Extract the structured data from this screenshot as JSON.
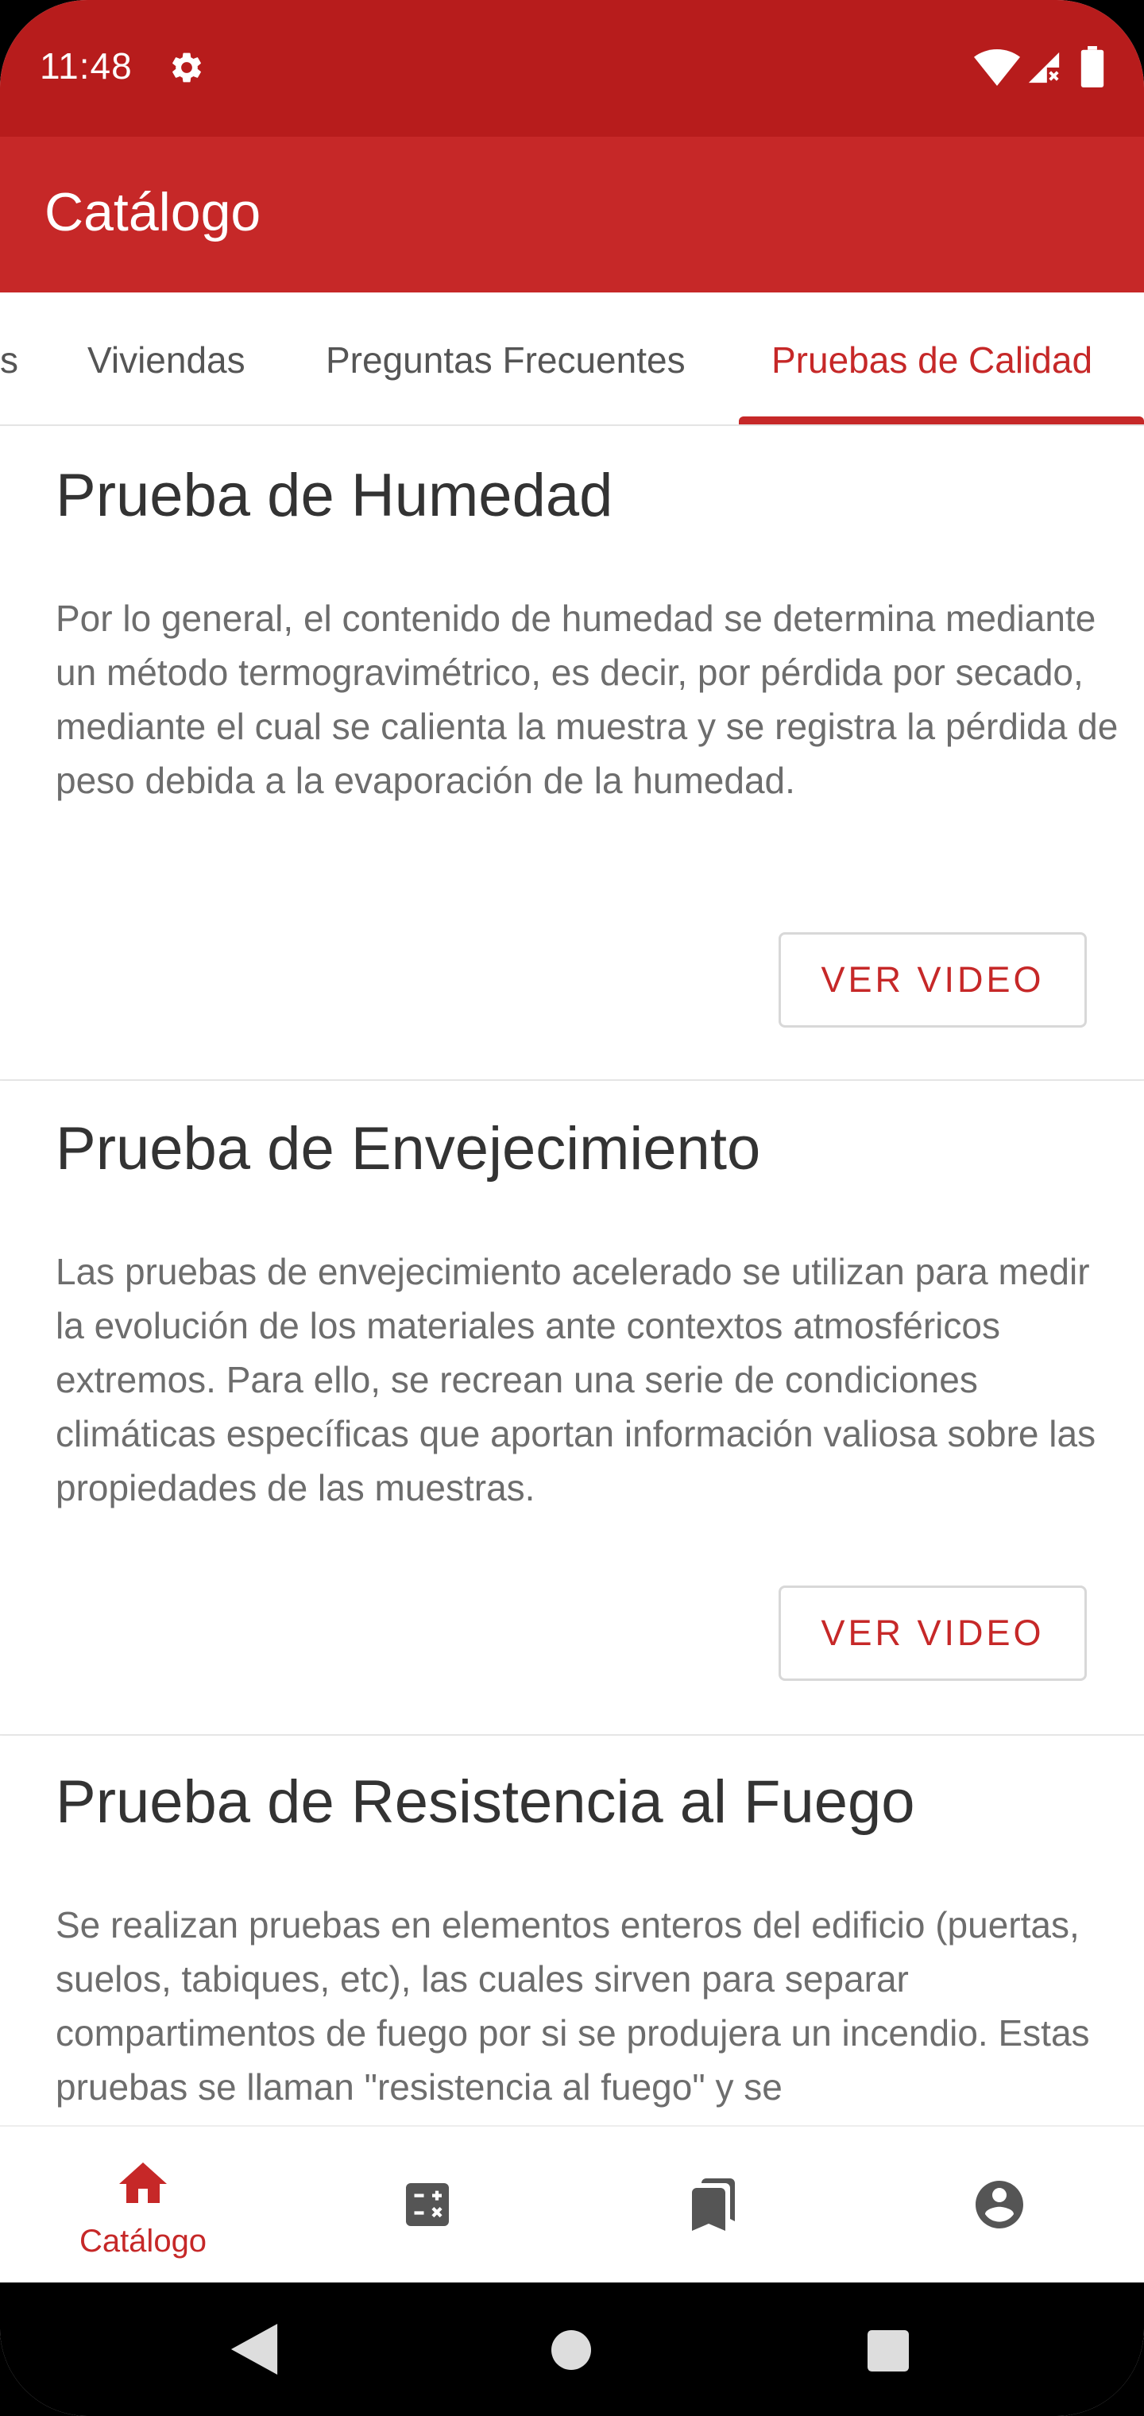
{
  "status_bar": {
    "time": "11:48"
  },
  "app_bar": {
    "title": "Catálogo"
  },
  "tabs": {
    "partial_label": "s",
    "items": [
      {
        "label": "Viviendas"
      },
      {
        "label": "Preguntas Frecuentes"
      },
      {
        "label": "Pruebas de Calidad",
        "selected": true
      }
    ]
  },
  "cards": [
    {
      "title": "Prueba de Humedad",
      "body": "Por lo general, el contenido de humedad se determina mediante un método termogravimétrico, es decir, por pérdida por secado, mediante el cual se calienta la muestra y se registra la pérdida de peso debida a la evaporación de la humedad.",
      "button": "VER VIDEO"
    },
    {
      "title": "Prueba de Envejecimiento",
      "body": "Las pruebas de envejecimiento acelerado se utilizan para medir la evolución de los materiales ante contextos atmosféricos extremos. Para ello, se recrean una serie de condiciones climáticas específicas que aportan información valiosa sobre las propiedades de las muestras.",
      "button": "VER VIDEO"
    },
    {
      "title": "Prueba de Resistencia al Fuego",
      "body": "Se realizan pruebas en elementos enteros del edificio (puertas, suelos, tabiques, etc), las cuales sirven para separar compartimentos de fuego por si se produjera un incendio. Estas pruebas se llaman \"resistencia al fuego\" y se"
    }
  ],
  "bottom_nav": {
    "items": [
      {
        "icon": "home-icon",
        "label": "Catálogo",
        "active": true
      },
      {
        "icon": "calculator-icon"
      },
      {
        "icon": "bookmarks-icon"
      },
      {
        "icon": "account-circle-icon"
      }
    ]
  },
  "colors": {
    "status_bar": "#B71C1C",
    "app_bar": "#C62828",
    "accent": "#C62828"
  }
}
